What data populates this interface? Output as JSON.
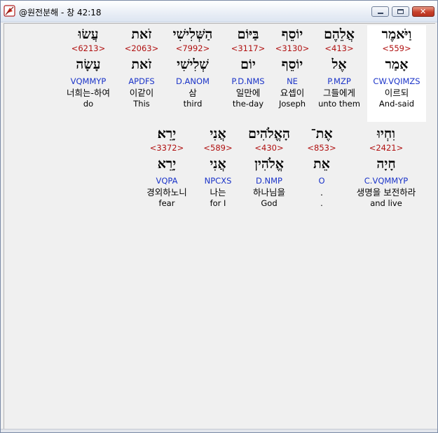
{
  "window": {
    "title": "@원전분해 - 창 42:18",
    "app_icon": "dictionary-app-icon",
    "buttons": {
      "minimize": "minimize-icon",
      "maximize": "maximize-icon",
      "close": "close-icon",
      "close_glyph": "✕"
    }
  },
  "row1": [
    {
      "hebrew": "וַיֹּאמֶר",
      "strong": "<559>",
      "lemma": "אָמַר",
      "parse": "CW.VQIMZS",
      "korean": "이르되",
      "english": "And-said",
      "selected": true
    },
    {
      "hebrew": "אֲלֵהֶם",
      "strong": "<413>",
      "lemma": "אֶל",
      "parse": "P.MZP",
      "korean": "그들에게",
      "english": "unto them",
      "selected": false
    },
    {
      "hebrew": "יוֹסֵף",
      "strong": "<3130>",
      "lemma": "יוֹסֵף",
      "parse": "NE",
      "korean": "요셉이",
      "english": "Joseph",
      "selected": false
    },
    {
      "hebrew": "בַּיּוֹם",
      "strong": "<3117>",
      "lemma": "יוֹם",
      "parse": "P.D.NMS",
      "korean": "일만에",
      "english": "the-day",
      "selected": false
    },
    {
      "hebrew": "הַשְּׁלִישִׁי",
      "strong": "<7992>",
      "lemma": "שְׁלִישִׁי",
      "parse": "D.ANOM",
      "korean": "삼",
      "english": "third",
      "selected": false
    },
    {
      "hebrew": "זֹאת",
      "strong": "<2063>",
      "lemma": "זֹאת",
      "parse": "APDFS",
      "korean": "이같이",
      "english": "This",
      "selected": false
    },
    {
      "hebrew": "עֲשׂוּ",
      "strong": "<6213>",
      "lemma": "עָשָׂה",
      "parse": "VQMMYP",
      "korean": "너희는-하여",
      "english": "do",
      "selected": false
    }
  ],
  "row2": [
    {
      "hebrew": "וִחְיוּ",
      "strong": "<2421>",
      "lemma": "חָיָה",
      "parse": "C.VQMMYP",
      "korean": "생명을 보전하라",
      "english": "and live"
    },
    {
      "hebrew": "אֶת־",
      "strong": "<853>",
      "lemma": "אֵת",
      "parse": "O",
      "korean": ".",
      "english": "."
    },
    {
      "hebrew": "הָאֱלֹהִים",
      "strong": "<430>",
      "lemma": "אֱלֹהִין",
      "parse": "D.NMP",
      "korean": "하나님을",
      "english": "God"
    },
    {
      "hebrew": "אֲנִי",
      "strong": "<589>",
      "lemma": "אֲנִי",
      "parse": "NPCXS",
      "korean": "나는",
      "english": "for I"
    },
    {
      "hebrew": "יָרֵא׃",
      "strong": "<3372>",
      "lemma": "יָרֵא",
      "parse": "VQPA",
      "korean": "경외하노니",
      "english": "fear"
    }
  ]
}
